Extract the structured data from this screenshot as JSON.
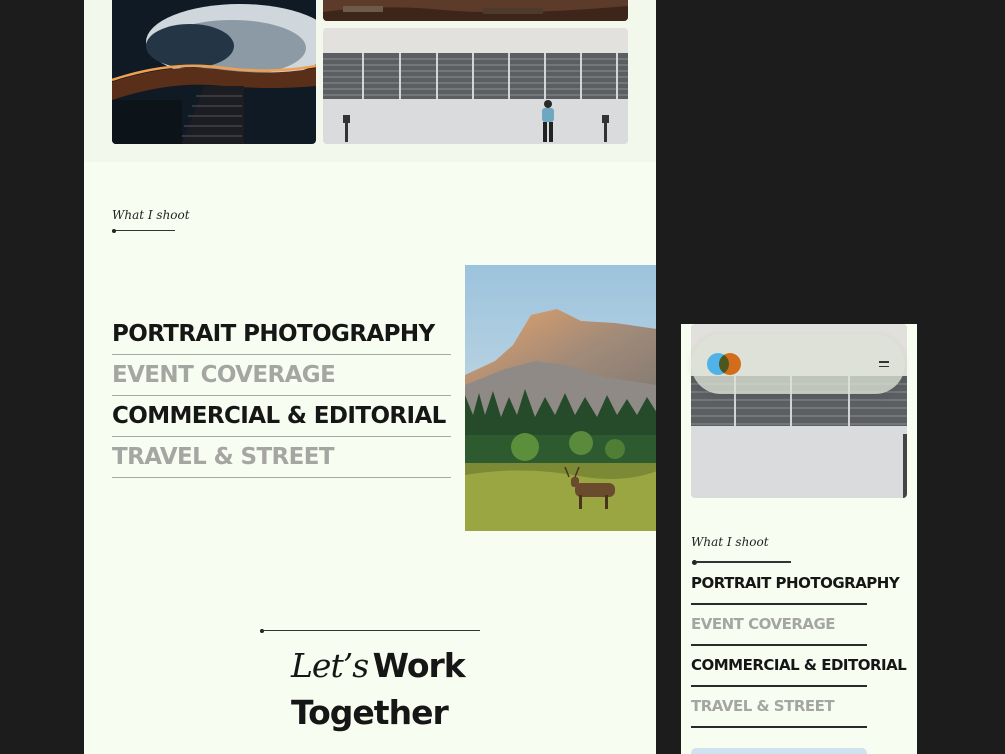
{
  "desktop": {
    "section_label": "What I shoot",
    "services": [
      {
        "label": "PORTRAIT PHOTOGRAPHY",
        "style": "dark"
      },
      {
        "label": "EVENT COVERAGE",
        "style": "muted"
      },
      {
        "label": "COMMERCIAL & EDITORIAL",
        "style": "dark"
      },
      {
        "label": "TRAVEL & STREET",
        "style": "muted"
      }
    ],
    "cta": {
      "italic": "Let’s",
      "bold_1": "Work",
      "bold_2": "Together"
    }
  },
  "mobile": {
    "section_label": "What I shoot",
    "services": [
      {
        "label": "PORTRAIT PHOTOGRAPHY",
        "style": "dark"
      },
      {
        "label": "EVENT COVERAGE",
        "style": "muted"
      },
      {
        "label": "COMMERCIAL & EDITORIAL",
        "style": "dark"
      },
      {
        "label": "TRAVEL & STREET",
        "style": "muted"
      }
    ],
    "menu_icon": "menu-icon",
    "logo_colors": [
      "#4fb3e8",
      "#f47b20"
    ]
  },
  "colors": {
    "page_background": "#1c1c1c",
    "frame_background": "#f7fdf1",
    "dark_text": "#161616",
    "muted_text": "#a5a6a2"
  },
  "images": [
    "spiral-staircase-photo",
    "desert-landscape-photo",
    "building-facade-person-photo",
    "half-dome-elk-meadow-photo"
  ]
}
